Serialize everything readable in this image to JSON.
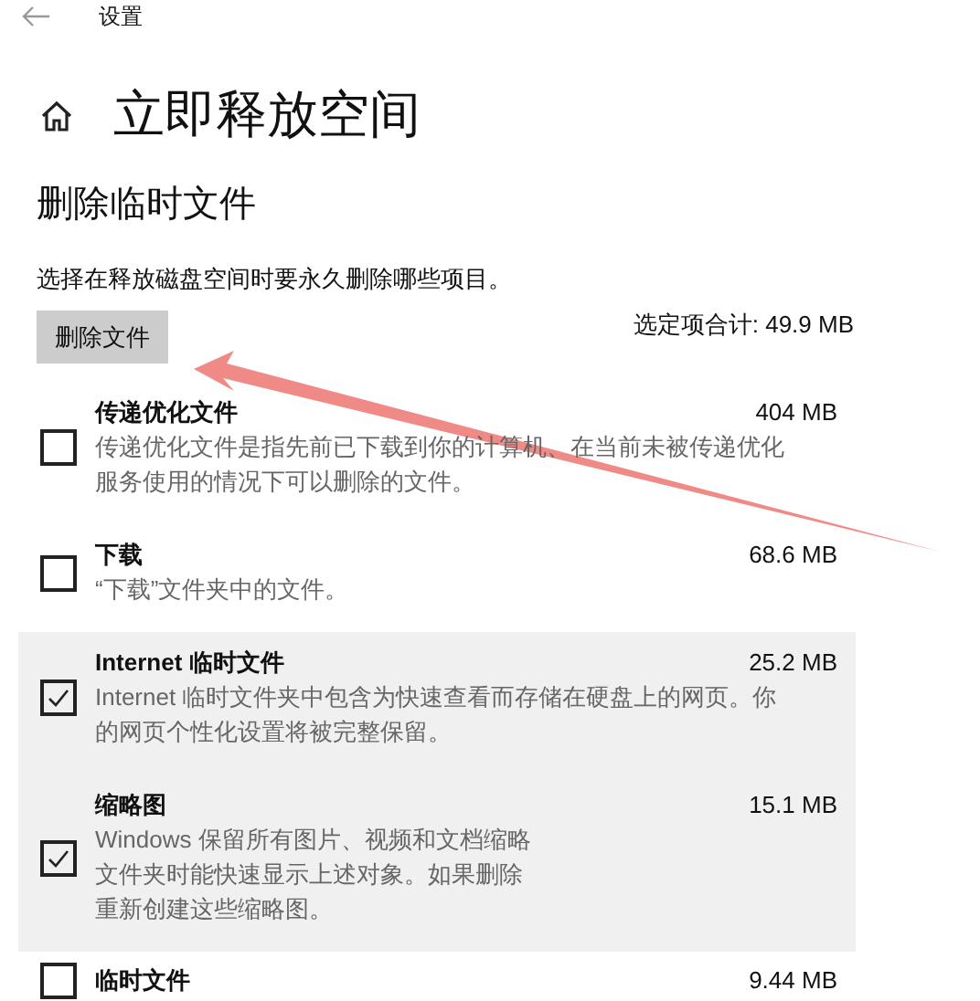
{
  "window": {
    "title": "设置"
  },
  "page": {
    "title": "立即释放空间",
    "section": "删除临时文件",
    "description": "选择在释放磁盘空间时要永久删除哪些项目。",
    "button": "删除文件",
    "total": "选定项合计: 49.9 MB"
  },
  "items": [
    {
      "name": "传递优化文件",
      "size": "404 MB",
      "checked": false,
      "lines": [
        "传递优化文件是指先前已下载到你的计算机、在当前未被传递优化",
        "服务使用的情况下可以删除的文件。"
      ]
    },
    {
      "name": "下载",
      "size": "68.6 MB",
      "checked": false,
      "lines": [
        "“下载”文件夹中的文件。"
      ]
    },
    {
      "name": "Internet 临时文件",
      "size": "25.2 MB",
      "checked": true,
      "lines": [
        "Internet 临时文件夹中包含为快速查看而存储在硬盘上的网页。你",
        "的网页个性化设置将被完整保留。"
      ]
    },
    {
      "name": "缩略图",
      "size": "15.1 MB",
      "checked": true,
      "lines": [
        "Windows 保留所有图片、视频和文档缩略",
        "文件夹时能快速显示上述对象。如果删除",
        "重新创建这些缩略图。"
      ]
    },
    {
      "name": "临时文件",
      "size": "9.44 MB",
      "checked": false
    }
  ]
}
